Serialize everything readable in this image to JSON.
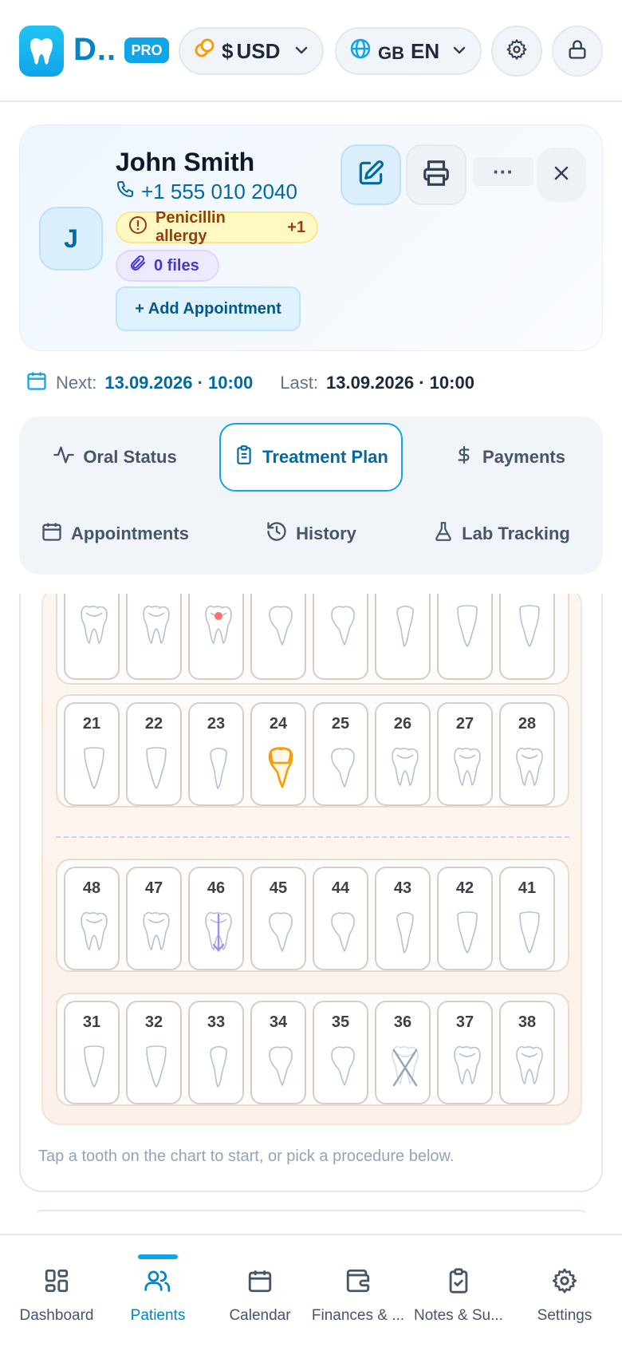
{
  "header": {
    "app_title": "D..",
    "badge": "PRO",
    "currency": {
      "symbol": "$",
      "code": "USD"
    },
    "language": {
      "flag_text": "GB",
      "code": "EN"
    }
  },
  "patient": {
    "initial": "J",
    "name": "John Smith",
    "phone": "+1 555 010 2040",
    "allergy": "Penicillin allergy",
    "allergy_more": "+1",
    "files": "0 files",
    "add_appointment": "+ Add Appointment",
    "more_label": "···"
  },
  "schedule": {
    "next_label": "Next:",
    "next_value": "13.09.2026 · 10:00",
    "last_label": "Last:",
    "last_value": "13.09.2026 · 10:00"
  },
  "tabs": [
    {
      "label": "Oral Status",
      "icon": "activity-icon"
    },
    {
      "label": "Treatment Plan",
      "icon": "clipboard-icon",
      "active": true
    },
    {
      "label": "Payments",
      "icon": "dollar-icon"
    },
    {
      "label": "Appointments",
      "icon": "calendar-icon"
    },
    {
      "label": "History",
      "icon": "history-icon"
    },
    {
      "label": "Lab Tracking",
      "icon": "flask-icon"
    }
  ],
  "chart": {
    "upper_right": {
      "numbers": [
        "",
        "",
        "",
        "",
        "",
        "",
        "",
        ""
      ],
      "types": [
        "molar",
        "molar",
        "molar",
        "premolar",
        "premolar",
        "canine",
        "incisor",
        "incisor"
      ],
      "marks": [
        "",
        "",
        "caries",
        "",
        "",
        "",
        "",
        ""
      ]
    },
    "upper_left": {
      "numbers": [
        "21",
        "22",
        "23",
        "24",
        "25",
        "26",
        "27",
        "28"
      ],
      "types": [
        "incisor",
        "incisor",
        "canine",
        "premolar",
        "premolar",
        "molar",
        "molar",
        "molar"
      ],
      "marks": [
        "",
        "",
        "",
        "crown",
        "",
        "",
        "",
        ""
      ]
    },
    "lower_right": {
      "numbers": [
        "48",
        "47",
        "46",
        "45",
        "44",
        "43",
        "42",
        "41"
      ],
      "types": [
        "molar",
        "molar",
        "molar",
        "premolar",
        "premolar",
        "canine",
        "incisor",
        "incisor"
      ],
      "marks": [
        "",
        "",
        "extrusion",
        "",
        "",
        "",
        "",
        ""
      ]
    },
    "lower_left": {
      "numbers": [
        "31",
        "32",
        "33",
        "34",
        "35",
        "36",
        "37",
        "38"
      ],
      "types": [
        "incisor",
        "incisor",
        "canine",
        "premolar",
        "premolar",
        "molar",
        "molar",
        "molar"
      ],
      "marks": [
        "",
        "",
        "",
        "",
        "",
        "missing",
        "",
        ""
      ]
    },
    "hint": "Tap a tooth on the chart to start, or pick a procedure below.",
    "colors": {
      "crown": "#f59e0b",
      "caries": "#f87171",
      "extrusion": "#a78bfa",
      "missing": "#94a3b8",
      "outline": "#b6c2d4"
    }
  },
  "nav": [
    {
      "label": "Dashboard",
      "icon": "grid-icon"
    },
    {
      "label": "Patients",
      "icon": "users-icon",
      "active": true
    },
    {
      "label": "Calendar",
      "icon": "calendar-icon"
    },
    {
      "label": "Finances & ...",
      "icon": "wallet-icon"
    },
    {
      "label": "Notes & Su...",
      "icon": "clipboard-check-icon"
    },
    {
      "label": "Settings",
      "icon": "gear-icon"
    }
  ]
}
